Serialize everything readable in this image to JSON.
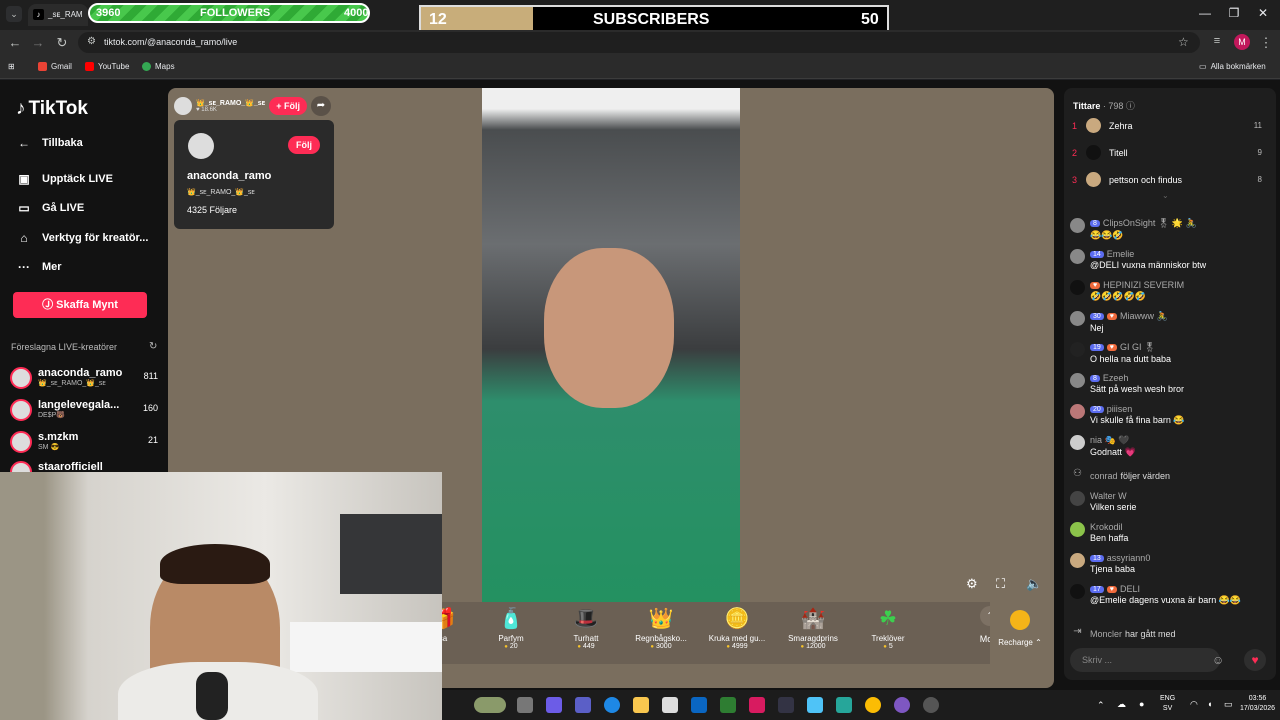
{
  "overlay": {
    "followers": {
      "current": "3960",
      "label": "FOLLOWERS",
      "goal": "4000",
      "progress": 0.99
    },
    "subscribers": {
      "current": "12",
      "label": "SUBSCRIBERS",
      "goal": "50",
      "progress": 0.24
    }
  },
  "browser": {
    "tab_title": "_sᴇ_RAM",
    "url": "tiktok.com/@anaconda_ramo/live",
    "bookmarks": [
      "Gmail",
      "YouTube",
      "Maps"
    ],
    "all_bookmarks": "Alla bokmärken",
    "profile_initial": "M"
  },
  "sidebar": {
    "logo": "TikTok",
    "back": "Tillbaka",
    "nav": [
      "Upptäck LIVE",
      "Gå LIVE",
      "Verktyg för kreatör...",
      "Mer"
    ],
    "coins_button": "Skaffa Mynt",
    "suggested_title": "Föreslagna LIVE-kreatörer",
    "suggested": [
      {
        "name": "anaconda_ramo",
        "sub": "👑_sᴇ_RAMO_👑_sᴇ",
        "count": "811"
      },
      {
        "name": "langelevegala...",
        "sub": "DE$P🐻",
        "count": "160"
      },
      {
        "name": "s.mzkm",
        "sub": "SM 😎",
        "count": "21"
      },
      {
        "name": "staarofficiell",
        "sub": "",
        "count": ""
      }
    ]
  },
  "host": {
    "name": "👑_sᴇ_RAMO_👑_sᴇ",
    "likes": "18.6K",
    "follow": "+ Följ",
    "card": {
      "follow": "Följ",
      "username": "anaconda_ramo",
      "label": "👑_sᴇ_RAMO_👑_sᴇ",
      "followers": "4325 Följare"
    }
  },
  "gifts": [
    {
      "name": "sa",
      "price": "",
      "icon": "🎁"
    },
    {
      "name": "Parfym",
      "price": "20",
      "icon": "🧴"
    },
    {
      "name": "Turhatt",
      "price": "449",
      "icon": "🎩"
    },
    {
      "name": "Regnbågsko...",
      "price": "3000",
      "icon": "👑"
    },
    {
      "name": "Kruka med gu...",
      "price": "4999",
      "icon": "🪙"
    },
    {
      "name": "Smaragdprins",
      "price": "12000",
      "icon": "🏰"
    },
    {
      "name": "Treklöver",
      "price": "5",
      "icon": "☘"
    }
  ],
  "more_label": "More",
  "recharge_label": "Recharge ⌃",
  "chat": {
    "viewers_label": "Tittare",
    "viewers_count": "· 798",
    "top": [
      {
        "rank": "1",
        "name": "Zehra",
        "points": "11"
      },
      {
        "rank": "2",
        "name": "Titell",
        "points": "9"
      },
      {
        "rank": "3",
        "name": "pettson och findus",
        "points": "8"
      }
    ],
    "messages": [
      {
        "level": "8",
        "fan": "",
        "user": "ClipsOnSight 🎖 🌟 🚴",
        "text": "😂😂🤣"
      },
      {
        "level": "14",
        "fan": "",
        "user": "Emelie",
        "text": "@DELI vuxna människor btw"
      },
      {
        "level": "",
        "fan": "♥",
        "user": "HEPINIZI SEVERIM",
        "text": "🤣🤣🤣🤣🤣"
      },
      {
        "level": "30",
        "fan": "♥",
        "user": "Miawww 🚴",
        "text": "Nej"
      },
      {
        "level": "19",
        "fan": "♥",
        "user": "GI GI 🎖",
        "text": "O hella na dutt baba"
      },
      {
        "level": "8",
        "fan": "",
        "user": "Ezeeh",
        "text": "Sätt på wesh wesh bror"
      },
      {
        "level": "20",
        "fan": "",
        "user": "piiisen",
        "text": "Vi skulle få fina barn 😂"
      },
      {
        "level": "",
        "fan": "",
        "user": "nia 🎭 🖤",
        "text": "Godnatt 💗"
      },
      {
        "level": "",
        "fan": "",
        "user": "conrad",
        "action": "följer värden",
        "text": ""
      },
      {
        "level": "",
        "fan": "",
        "user": "Walter W",
        "text": "Vilken serie"
      },
      {
        "level": "",
        "fan": "",
        "user": "Krokodil",
        "text": "Ben haffa"
      },
      {
        "level": "13",
        "fan": "",
        "user": "assyriann0",
        "text": "Tjena baba"
      },
      {
        "level": "17",
        "fan": "♥",
        "user": "DELI",
        "text": "@Emelie dagens vuxna är barn 😂😂"
      },
      {
        "level": "",
        "fan": "",
        "user": "Moncler",
        "action": "har gått med",
        "text": ""
      }
    ],
    "input_placeholder": "Skriv ..."
  },
  "taskbar": {
    "lang": "ENG",
    "lang2": "SV",
    "time": "03:56",
    "date": "17/03/2026"
  }
}
